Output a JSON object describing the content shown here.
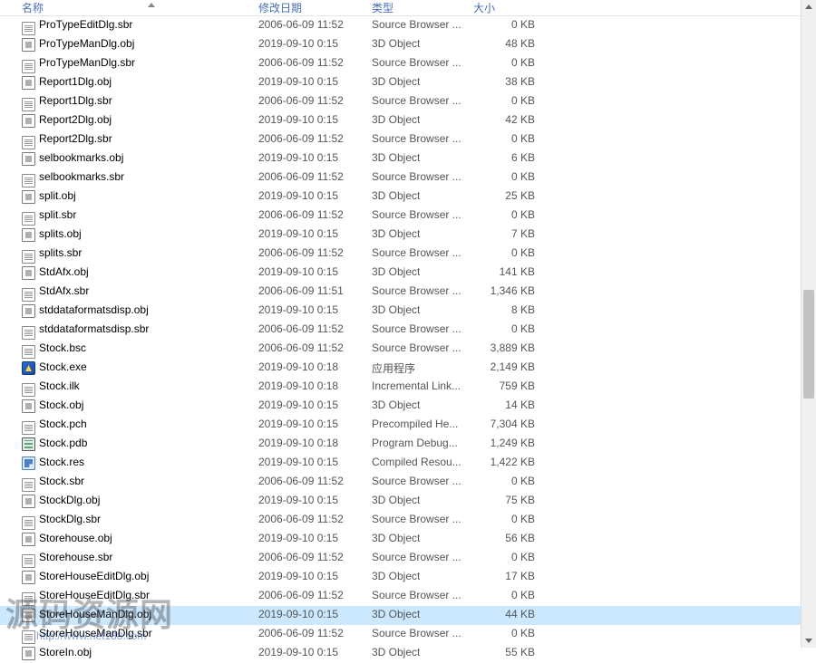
{
  "header": {
    "name": "名称",
    "date": "修改日期",
    "type": "类型",
    "size": "大小"
  },
  "files": [
    {
      "icon": "page",
      "name": "ProTypeEditDlg.sbr",
      "date": "2006-06-09 11:52",
      "type": "Source Browser ...",
      "size": "0 KB"
    },
    {
      "icon": "obj",
      "name": "ProTypeManDlg.obj",
      "date": "2019-09-10 0:15",
      "type": "3D Object",
      "size": "48 KB"
    },
    {
      "icon": "page",
      "name": "ProTypeManDlg.sbr",
      "date": "2006-06-09 11:52",
      "type": "Source Browser ...",
      "size": "0 KB"
    },
    {
      "icon": "obj",
      "name": "Report1Dlg.obj",
      "date": "2019-09-10 0:15",
      "type": "3D Object",
      "size": "38 KB"
    },
    {
      "icon": "page",
      "name": "Report1Dlg.sbr",
      "date": "2006-06-09 11:52",
      "type": "Source Browser ...",
      "size": "0 KB"
    },
    {
      "icon": "obj",
      "name": "Report2Dlg.obj",
      "date": "2019-09-10 0:15",
      "type": "3D Object",
      "size": "42 KB"
    },
    {
      "icon": "page",
      "name": "Report2Dlg.sbr",
      "date": "2006-06-09 11:52",
      "type": "Source Browser ...",
      "size": "0 KB"
    },
    {
      "icon": "obj",
      "name": "selbookmarks.obj",
      "date": "2019-09-10 0:15",
      "type": "3D Object",
      "size": "6 KB"
    },
    {
      "icon": "page",
      "name": "selbookmarks.sbr",
      "date": "2006-06-09 11:52",
      "type": "Source Browser ...",
      "size": "0 KB"
    },
    {
      "icon": "obj",
      "name": "split.obj",
      "date": "2019-09-10 0:15",
      "type": "3D Object",
      "size": "25 KB"
    },
    {
      "icon": "page",
      "name": "split.sbr",
      "date": "2006-06-09 11:52",
      "type": "Source Browser ...",
      "size": "0 KB"
    },
    {
      "icon": "obj",
      "name": "splits.obj",
      "date": "2019-09-10 0:15",
      "type": "3D Object",
      "size": "7 KB"
    },
    {
      "icon": "page",
      "name": "splits.sbr",
      "date": "2006-06-09 11:52",
      "type": "Source Browser ...",
      "size": "0 KB"
    },
    {
      "icon": "obj",
      "name": "StdAfx.obj",
      "date": "2019-09-10 0:15",
      "type": "3D Object",
      "size": "141 KB"
    },
    {
      "icon": "page",
      "name": "StdAfx.sbr",
      "date": "2006-06-09 11:51",
      "type": "Source Browser ...",
      "size": "1,346 KB"
    },
    {
      "icon": "obj",
      "name": "stddataformatsdisp.obj",
      "date": "2019-09-10 0:15",
      "type": "3D Object",
      "size": "8 KB"
    },
    {
      "icon": "page",
      "name": "stddataformatsdisp.sbr",
      "date": "2006-06-09 11:52",
      "type": "Source Browser ...",
      "size": "0 KB"
    },
    {
      "icon": "page",
      "name": "Stock.bsc",
      "date": "2006-06-09 11:52",
      "type": "Source Browser ...",
      "size": "3,889 KB"
    },
    {
      "icon": "exe",
      "name": "Stock.exe",
      "date": "2019-09-10 0:18",
      "type": "应用程序",
      "size": "2,149 KB"
    },
    {
      "icon": "page",
      "name": "Stock.ilk",
      "date": "2019-09-10 0:18",
      "type": "Incremental Link...",
      "size": "759 KB"
    },
    {
      "icon": "obj",
      "name": "Stock.obj",
      "date": "2019-09-10 0:15",
      "type": "3D Object",
      "size": "14 KB"
    },
    {
      "icon": "page",
      "name": "Stock.pch",
      "date": "2019-09-10 0:15",
      "type": "Precompiled He...",
      "size": "7,304 KB"
    },
    {
      "icon": "pdb",
      "name": "Stock.pdb",
      "date": "2019-09-10 0:18",
      "type": "Program Debug...",
      "size": "1,249 KB"
    },
    {
      "icon": "res",
      "name": "Stock.res",
      "date": "2019-09-10 0:15",
      "type": "Compiled Resou...",
      "size": "1,422 KB"
    },
    {
      "icon": "page",
      "name": "Stock.sbr",
      "date": "2006-06-09 11:52",
      "type": "Source Browser ...",
      "size": "0 KB"
    },
    {
      "icon": "obj",
      "name": "StockDlg.obj",
      "date": "2019-09-10 0:15",
      "type": "3D Object",
      "size": "75 KB"
    },
    {
      "icon": "page",
      "name": "StockDlg.sbr",
      "date": "2006-06-09 11:52",
      "type": "Source Browser ...",
      "size": "0 KB"
    },
    {
      "icon": "obj",
      "name": "Storehouse.obj",
      "date": "2019-09-10 0:15",
      "type": "3D Object",
      "size": "56 KB"
    },
    {
      "icon": "page",
      "name": "Storehouse.sbr",
      "date": "2006-06-09 11:52",
      "type": "Source Browser ...",
      "size": "0 KB"
    },
    {
      "icon": "obj",
      "name": "StoreHouseEditDlg.obj",
      "date": "2019-09-10 0:15",
      "type": "3D Object",
      "size": "17 KB"
    },
    {
      "icon": "page",
      "name": "StoreHouseEditDlg.sbr",
      "date": "2006-06-09 11:52",
      "type": "Source Browser ...",
      "size": "0 KB"
    },
    {
      "icon": "obj",
      "name": "StoreHouseManDlg.obj",
      "date": "2019-09-10 0:15",
      "type": "3D Object",
      "size": "44 KB",
      "selected": true
    },
    {
      "icon": "page",
      "name": "StoreHouseManDlg.sbr",
      "date": "2006-06-09 11:52",
      "type": "Source Browser ...",
      "size": "0 KB"
    },
    {
      "icon": "obj",
      "name": "StoreIn.obj",
      "date": "2019-09-10 0:15",
      "type": "3D Object",
      "size": "55 KB"
    }
  ],
  "watermark": {
    "big": "源码资源网",
    "small": "http://www.net188.com"
  }
}
